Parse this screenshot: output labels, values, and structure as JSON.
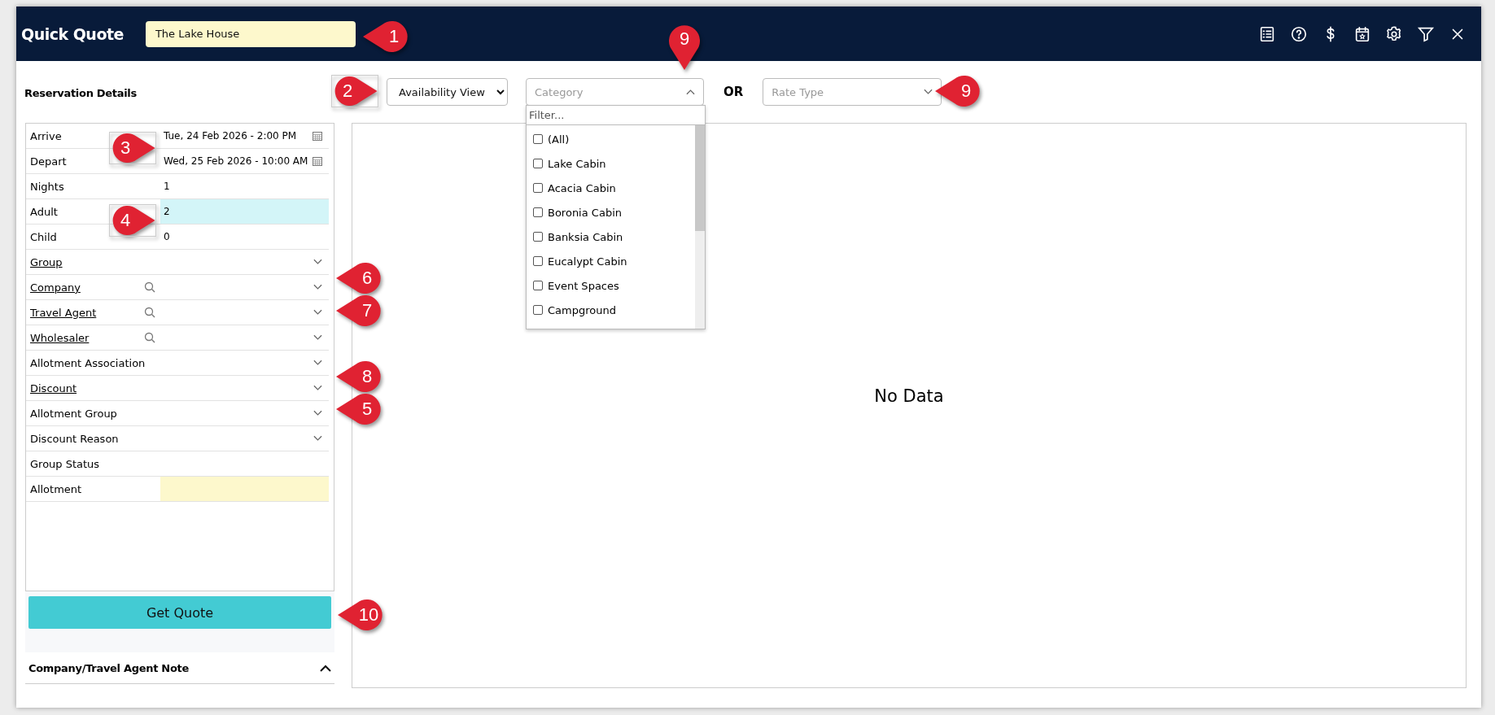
{
  "header": {
    "title": "Quick Quote",
    "name_field": {
      "value": "The Lake House"
    }
  },
  "toolbar": {
    "section_title": "Reservation Details",
    "view_select": {
      "value": "Availability View"
    },
    "category_select": {
      "placeholder": "Category",
      "expanded": true,
      "filter_placeholder": "Filter...",
      "options": [
        {
          "label": "(All)",
          "checked": false
        },
        {
          "label": "Lake Cabin",
          "checked": false
        },
        {
          "label": "Acacia Cabin",
          "checked": false
        },
        {
          "label": "Boronia Cabin",
          "checked": false
        },
        {
          "label": "Banksia Cabin",
          "checked": false
        },
        {
          "label": "Eucalypt Cabin",
          "checked": false
        },
        {
          "label": "Event Spaces",
          "checked": false
        },
        {
          "label": "Campground",
          "checked": false
        }
      ]
    },
    "or_label": "OR",
    "rate_type_select": {
      "placeholder": "Rate Type",
      "expanded": false
    }
  },
  "details": [
    {
      "kind": "date",
      "label": "Arrive",
      "value": "Tue, 24 Feb 2026 - 2:00 PM"
    },
    {
      "kind": "date",
      "label": "Depart",
      "value": "Wed, 25 Feb 2026 - 10:00 AM"
    },
    {
      "kind": "text",
      "label": "Nights",
      "value": "1",
      "focused": false,
      "required": false
    },
    {
      "kind": "text",
      "label": "Adult",
      "value": "2",
      "focused": true,
      "required": false
    },
    {
      "kind": "text",
      "label": "Child",
      "value": "0",
      "focused": false,
      "required": false
    },
    {
      "kind": "select",
      "label": "Group",
      "link": true
    },
    {
      "kind": "lookup",
      "label": "Company",
      "link": true
    },
    {
      "kind": "lookup",
      "label": "Travel Agent",
      "link": true
    },
    {
      "kind": "lookup",
      "label": "Wholesaler",
      "link": true
    },
    {
      "kind": "select",
      "label": "Allotment Association",
      "link": false
    },
    {
      "kind": "select",
      "label": "Discount",
      "link": true
    },
    {
      "kind": "select",
      "label": "Allotment Group",
      "link": false
    },
    {
      "kind": "select",
      "label": "Discount Reason",
      "link": false
    },
    {
      "kind": "plain",
      "label": "Group Status"
    },
    {
      "kind": "text",
      "label": "Allotment",
      "focused": false,
      "required": true
    }
  ],
  "get_quote_button": "Get Quote",
  "note_section": {
    "title": "Company/Travel Agent Note",
    "expanded": true
  },
  "results": {
    "empty_message": "No Data"
  },
  "callouts": [
    {
      "number": "1"
    },
    {
      "number": "2"
    },
    {
      "number": "3"
    },
    {
      "number": "4"
    },
    {
      "number": "6"
    },
    {
      "number": "7"
    },
    {
      "number": "8"
    },
    {
      "number": "5"
    },
    {
      "number": "9"
    },
    {
      "number": "9"
    },
    {
      "number": "10"
    }
  ]
}
